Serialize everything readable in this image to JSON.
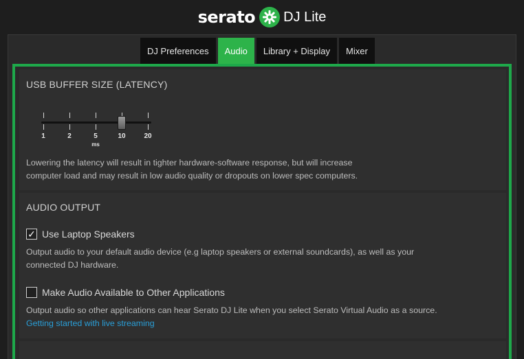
{
  "header": {
    "brand": "serato",
    "product": "DJ Lite",
    "logo_icon": "serato-logo-icon"
  },
  "tabs": [
    {
      "label": "DJ Preferences",
      "active": false
    },
    {
      "label": "Audio",
      "active": true
    },
    {
      "label": "Library + Display",
      "active": false
    },
    {
      "label": "Mixer",
      "active": false
    }
  ],
  "buffer": {
    "title": "USB BUFFER SIZE (LATENCY)",
    "ticks": [
      "1",
      "2",
      "5",
      "10",
      "20"
    ],
    "unit": "ms",
    "selected_value": "10",
    "desc_line1": "Lowering the latency will result in tighter hardware-software response, but will increase",
    "desc_line2": "computer load and may result in low audio quality or dropouts on lower spec computers."
  },
  "output": {
    "title": "AUDIO OUTPUT",
    "laptop": {
      "label": "Use Laptop Speakers",
      "checked": true,
      "desc_line1": "Output audio to your default audio device (e.g laptop speakers or external soundcards), as well as your",
      "desc_line2": "connected DJ hardware."
    },
    "share": {
      "label": "Make Audio Available to Other Applications",
      "checked": false,
      "desc_line1": "Output audio so other applications can hear Serato DJ Lite when you select Serato Virtual Audio as a source.",
      "link": "Getting started with live streaming"
    }
  },
  "colors": {
    "accent": "#1ea84a",
    "tab_active": "#2db34a",
    "link": "#2a9fd8",
    "background": "#1e1e1e",
    "section": "#2f2f2f"
  }
}
